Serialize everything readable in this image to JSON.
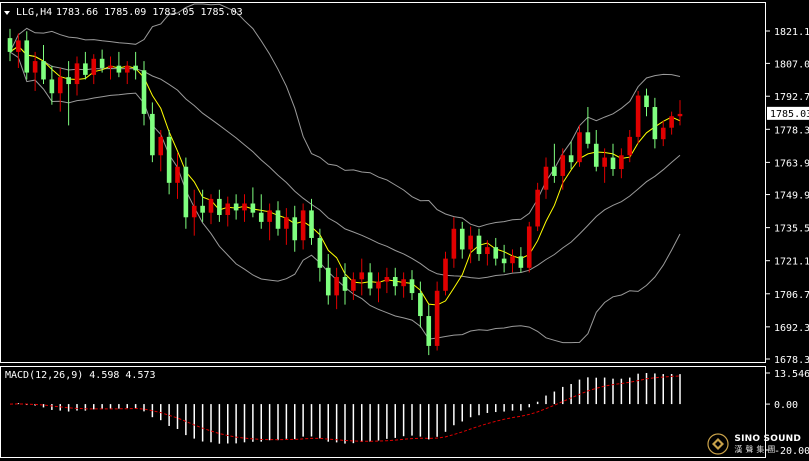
{
  "chart_data": [
    {
      "type": "candlestick",
      "symbol_timeframe": "LLG,H4",
      "ohlc_header": "1783.66 1785.09 1783.05 1785.03",
      "y_ticks": [
        "1821.10",
        "1807.00",
        "1792.70",
        "1778.30",
        "1763.90",
        "1749.90",
        "1735.50",
        "1721.10",
        "1706.70",
        "1692.30",
        "1678.30"
      ],
      "ylim": [
        1678.3,
        1821.1
      ],
      "current_price": "1785.03",
      "colors": {
        "up": "#e00000",
        "down": "#7fff7f",
        "ma": "#ffff00",
        "bands": "#9a9a9a",
        "grid": "#ffffff",
        "price_box": "#ffffff"
      },
      "indicators": [
        "Bollinger Bands",
        "Moving Average"
      ],
      "candles_ohlc": [
        [
          1818,
          1822,
          1808,
          1812
        ],
        [
          1812,
          1820,
          1805,
          1817
        ],
        [
          1817,
          1821,
          1800,
          1803
        ],
        [
          1803,
          1812,
          1795,
          1808
        ],
        [
          1808,
          1815,
          1798,
          1800
        ],
        [
          1800,
          1806,
          1789,
          1794
        ],
        [
          1794,
          1805,
          1786,
          1801
        ],
        [
          1801,
          1808,
          1780,
          1798
        ],
        [
          1798,
          1810,
          1793,
          1807
        ],
        [
          1807,
          1812,
          1800,
          1802
        ],
        [
          1802,
          1811,
          1798,
          1809
        ],
        [
          1809,
          1813,
          1803,
          1805
        ],
        [
          1805,
          1810,
          1800,
          1806
        ],
        [
          1806,
          1812,
          1801,
          1803
        ],
        [
          1803,
          1808,
          1798,
          1806
        ],
        [
          1806,
          1812,
          1800,
          1804
        ],
        [
          1804,
          1808,
          1780,
          1785
        ],
        [
          1785,
          1790,
          1764,
          1767
        ],
        [
          1767,
          1778,
          1760,
          1775
        ],
        [
          1775,
          1778,
          1750,
          1755
        ],
        [
          1755,
          1768,
          1748,
          1762
        ],
        [
          1762,
          1766,
          1735,
          1740
        ],
        [
          1740,
          1752,
          1732,
          1745
        ],
        [
          1745,
          1752,
          1738,
          1742
        ],
        [
          1742,
          1750,
          1737,
          1748
        ],
        [
          1748,
          1752,
          1738,
          1741
        ],
        [
          1741,
          1749,
          1736,
          1746
        ],
        [
          1746,
          1750,
          1739,
          1743
        ],
        [
          1743,
          1750,
          1738,
          1746
        ],
        [
          1746,
          1753,
          1740,
          1742
        ],
        [
          1742,
          1750,
          1735,
          1738
        ],
        [
          1738,
          1746,
          1730,
          1743
        ],
        [
          1743,
          1747,
          1732,
          1735
        ],
        [
          1735,
          1744,
          1728,
          1740
        ],
        [
          1740,
          1745,
          1725,
          1730
        ],
        [
          1730,
          1746,
          1726,
          1743
        ],
        [
          1743,
          1748,
          1728,
          1731
        ],
        [
          1731,
          1735,
          1712,
          1718
        ],
        [
          1718,
          1724,
          1702,
          1706
        ],
        [
          1706,
          1718,
          1700,
          1714
        ],
        [
          1714,
          1720,
          1702,
          1708
        ],
        [
          1708,
          1716,
          1704,
          1713
        ],
        [
          1713,
          1722,
          1706,
          1716
        ],
        [
          1716,
          1720,
          1706,
          1709
        ],
        [
          1709,
          1716,
          1703,
          1712
        ],
        [
          1712,
          1718,
          1707,
          1714
        ],
        [
          1714,
          1718,
          1706,
          1710
        ],
        [
          1710,
          1716,
          1705,
          1713
        ],
        [
          1713,
          1717,
          1704,
          1707
        ],
        [
          1707,
          1712,
          1692,
          1697
        ],
        [
          1697,
          1702,
          1680,
          1684
        ],
        [
          1684,
          1712,
          1682,
          1708
        ],
        [
          1708,
          1725,
          1706,
          1722
        ],
        [
          1722,
          1740,
          1718,
          1735
        ],
        [
          1735,
          1738,
          1722,
          1726
        ],
        [
          1726,
          1736,
          1720,
          1732
        ],
        [
          1732,
          1735,
          1721,
          1724
        ],
        [
          1724,
          1730,
          1719,
          1727
        ],
        [
          1727,
          1731,
          1719,
          1722
        ],
        [
          1722,
          1728,
          1716,
          1720
        ],
        [
          1720,
          1726,
          1716,
          1723
        ],
        [
          1723,
          1727,
          1716,
          1718
        ],
        [
          1718,
          1738,
          1716,
          1736
        ],
        [
          1736,
          1755,
          1734,
          1752
        ],
        [
          1752,
          1766,
          1748,
          1762
        ],
        [
          1762,
          1772,
          1755,
          1758
        ],
        [
          1758,
          1770,
          1752,
          1767
        ],
        [
          1767,
          1773,
          1761,
          1764
        ],
        [
          1764,
          1780,
          1762,
          1777
        ],
        [
          1777,
          1788,
          1770,
          1772
        ],
        [
          1772,
          1778,
          1760,
          1762
        ],
        [
          1762,
          1770,
          1755,
          1766
        ],
        [
          1766,
          1772,
          1758,
          1761
        ],
        [
          1761,
          1770,
          1757,
          1767
        ],
        [
          1767,
          1778,
          1764,
          1775
        ],
        [
          1775,
          1795,
          1772,
          1793
        ],
        [
          1793,
          1796,
          1784,
          1788
        ],
        [
          1788,
          1792,
          1770,
          1774
        ],
        [
          1774,
          1782,
          1771,
          1779
        ],
        [
          1779,
          1786,
          1776,
          1784
        ],
        [
          1784,
          1791,
          1780,
          1785
        ]
      ]
    },
    {
      "type": "histogram",
      "label": "MACD(12,26,9) 4.598 4.573",
      "y_ticks": [
        "13.546",
        "0.00",
        "-20.005"
      ],
      "ylim": [
        -20.005,
        13.546
      ],
      "colors": {
        "bars": "#ffffff",
        "signal": "#e00000"
      }
    }
  ],
  "logo": {
    "name": "SINO SOUND",
    "chinese": "漢聲集團"
  }
}
